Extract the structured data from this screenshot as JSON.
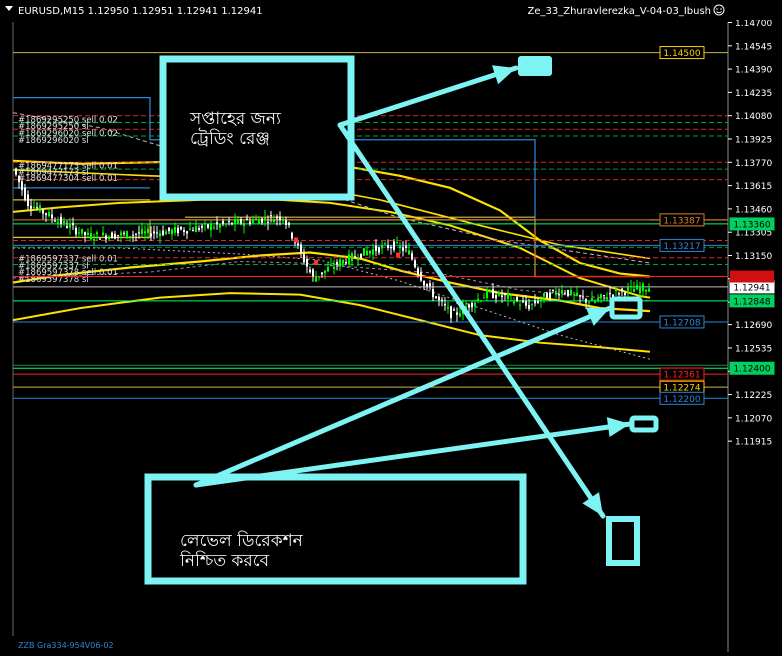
{
  "window": {
    "symbol_header": "EURUSD,M15  1.12950 1.12951 1.12941 1.12941",
    "expert_label": "Ze_33_Zhuravlerezka_V-04-03_Ibush",
    "bottom_label": "ZZB Gra334-954V06-02"
  },
  "colors": {
    "background": "#000000",
    "candle_up": "#00ff00",
    "candle_down": "#ffffff",
    "envelope": "#ffe000",
    "annotation": "#7ef3f4",
    "support": "#00ff66",
    "resistance": "#ff2020",
    "level_blue": "#2a86d8",
    "level_orange": "#d8812a"
  },
  "price_axis": {
    "min": 1.1185,
    "max": 1.1477,
    "ticks": [
      "1.14700",
      "1.14545",
      "1.14390",
      "1.14235",
      "1.14080",
      "1.13925",
      "1.13770",
      "1.13615",
      "1.13460",
      "1.13305",
      "1.13150",
      "1.12995",
      "1.12840",
      "1.12690",
      "1.12535",
      "1.12380",
      "1.12225",
      "1.12070",
      "1.11915"
    ]
  },
  "level_tags": [
    {
      "label": "1.14500",
      "price": 1.145,
      "bg": "#000000",
      "border": "#ffd000",
      "text": "#ffd000",
      "line": "#c8b640"
    },
    {
      "label": "1.13387",
      "price": 1.13387,
      "bg": "#000000",
      "border": "#d8812a",
      "text": "#d8812a",
      "line": "#d8812a"
    },
    {
      "label": "1.13360",
      "price": 1.1336,
      "bg": "#00d060",
      "border": "#00d060",
      "text": "#000000",
      "line": "#00ff66"
    },
    {
      "label": "1.13217",
      "price": 1.13217,
      "bg": "#000000",
      "border": "#2a86d8",
      "text": "#2a86d8",
      "line": "#2a86d8"
    },
    {
      "label": "1.12941",
      "price": 1.12941,
      "bg": "#ffffff",
      "border": "#ffffff",
      "text": "#000000",
      "line": "#c0c0c0"
    },
    {
      "label": "1.12848",
      "price": 1.12848,
      "bg": "#00d060",
      "border": "#00d060",
      "text": "#000000",
      "line": "#00ff66"
    },
    {
      "label": "1.12708",
      "price": 1.12708,
      "bg": "#000000",
      "border": "#2a86d8",
      "text": "#2a86d8",
      "line": "#2a86d8"
    },
    {
      "label": "1.12400",
      "price": 1.124,
      "bg": "#00d060",
      "border": "#00d060",
      "text": "#000000",
      "line": "#00ff66"
    },
    {
      "label": "1.12361",
      "price": 1.12361,
      "bg": "#000000",
      "border": "#ff2020",
      "text": "#ff2020",
      "line": "#ff2020"
    },
    {
      "label": "1.12274",
      "price": 1.12274,
      "bg": "#000000",
      "border": "#ffd000",
      "text": "#ffd000",
      "line": "#c8b640"
    },
    {
      "label": "1.12200",
      "price": 1.122,
      "bg": "#000000",
      "border": "#2a86d8",
      "text": "#2a86d8",
      "line": "#2a86d8"
    }
  ],
  "order_labels": [
    {
      "text": "#1869295250 sell 0.02",
      "price": 1.14055
    },
    {
      "text": "#1869295250 sl",
      "price": 1.1401
    },
    {
      "text": "#1869296020 sell 0.02",
      "price": 1.13965
    },
    {
      "text": "#1869296020 sl",
      "price": 1.1392
    },
    {
      "text": "#1869477173 sell 0.01",
      "price": 1.1375
    },
    {
      "text": "#1869477173 sl",
      "price": 1.13705
    },
    {
      "text": "#1869477304 sell 0.01",
      "price": 1.13665
    },
    {
      "text": "#1869597337 sell 0.01",
      "price": 1.1313
    },
    {
      "text": "#1869597337 sl",
      "price": 1.13085
    },
    {
      "text": "#1869597378 sell 0.01",
      "price": 1.1304
    },
    {
      "text": "#1869597378 sl",
      "price": 1.12995
    }
  ],
  "annotations": {
    "top_box_text": [
      "সপ্তাহের জন্য",
      "ট্রেডিং রেঞ্জ"
    ],
    "bottom_box_text": [
      "লেভেল ডিরেকশন",
      "নিশ্চিত করবে"
    ]
  }
}
